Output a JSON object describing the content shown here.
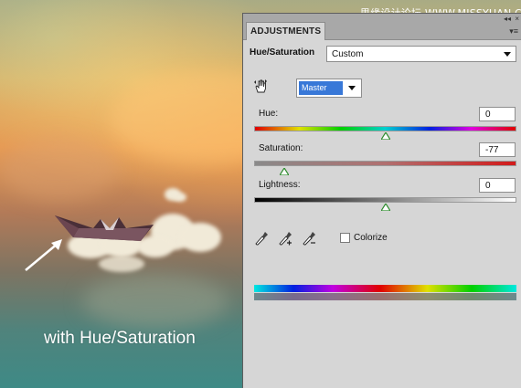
{
  "image": {
    "caption": "with Hue/Saturation",
    "watermark": "思缘设计论坛 WWW.MISSYUAN.COM"
  },
  "panel": {
    "tab_label": "ADJUSTMENTS",
    "title": "Hue/Saturation",
    "preset_value": "Custom",
    "channel_value": "Master",
    "hue": {
      "label": "Hue:",
      "value": "0"
    },
    "saturation": {
      "label": "Saturation:",
      "value": "-77"
    },
    "lightness": {
      "label": "Lightness:",
      "value": "0"
    },
    "colorize_label": "Colorize",
    "colorize_checked": false
  },
  "colors": {
    "panel_bg": "#d6d6d6",
    "tab_bar": "#a8a8a8",
    "selection": "#3878d8",
    "slider_thumb": "#2f8c2f"
  },
  "icons": [
    "on-image-adjust-hand-icon",
    "eyedropper-icon",
    "eyedropper-plus-icon",
    "eyedropper-minus-icon",
    "close-icon",
    "collapse-icon",
    "panel-menu-icon",
    "boat-image",
    "arrow-annotation"
  ]
}
